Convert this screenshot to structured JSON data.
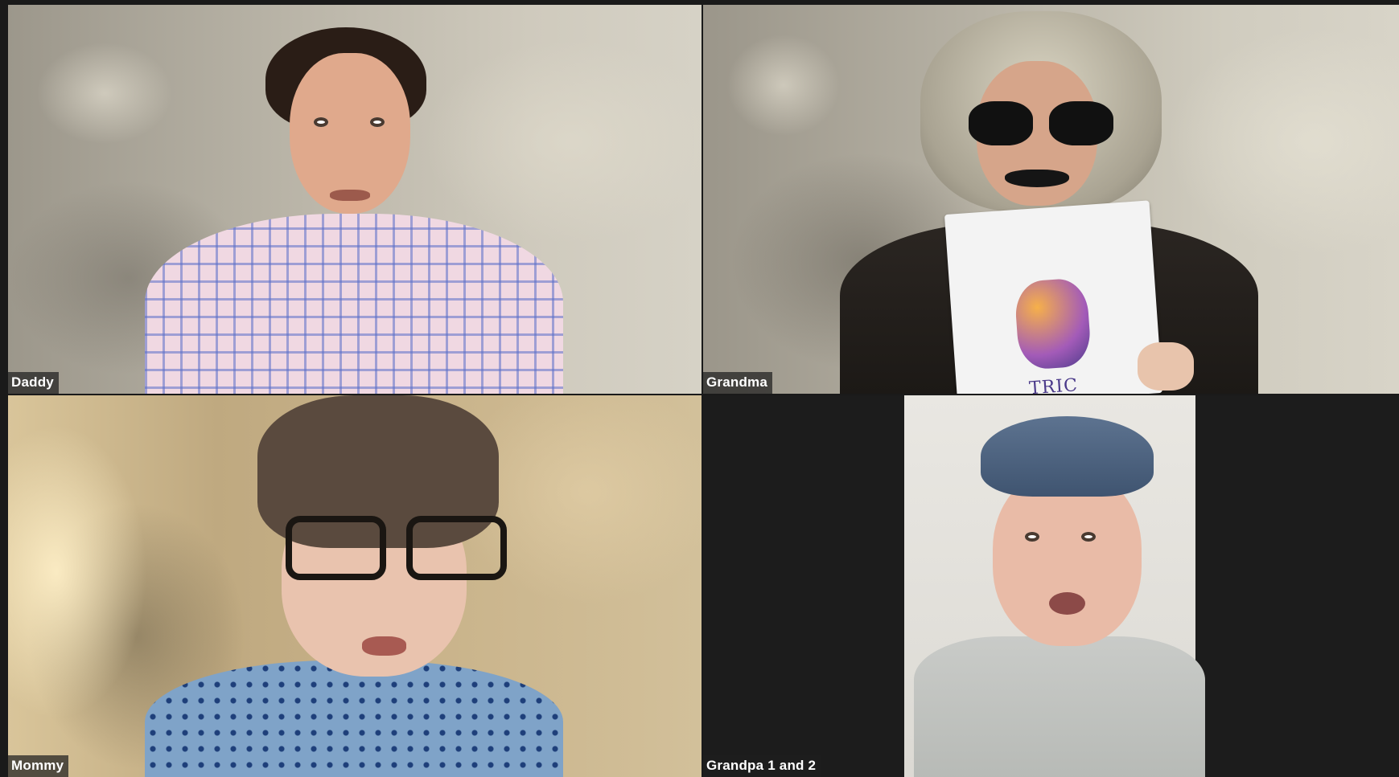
{
  "participants": [
    {
      "name": "Daddy"
    },
    {
      "name": "Grandma"
    },
    {
      "name": "Mommy"
    },
    {
      "name": "Grandpa 1 and 2"
    }
  ],
  "book": {
    "title_fragment": "TRIC"
  }
}
